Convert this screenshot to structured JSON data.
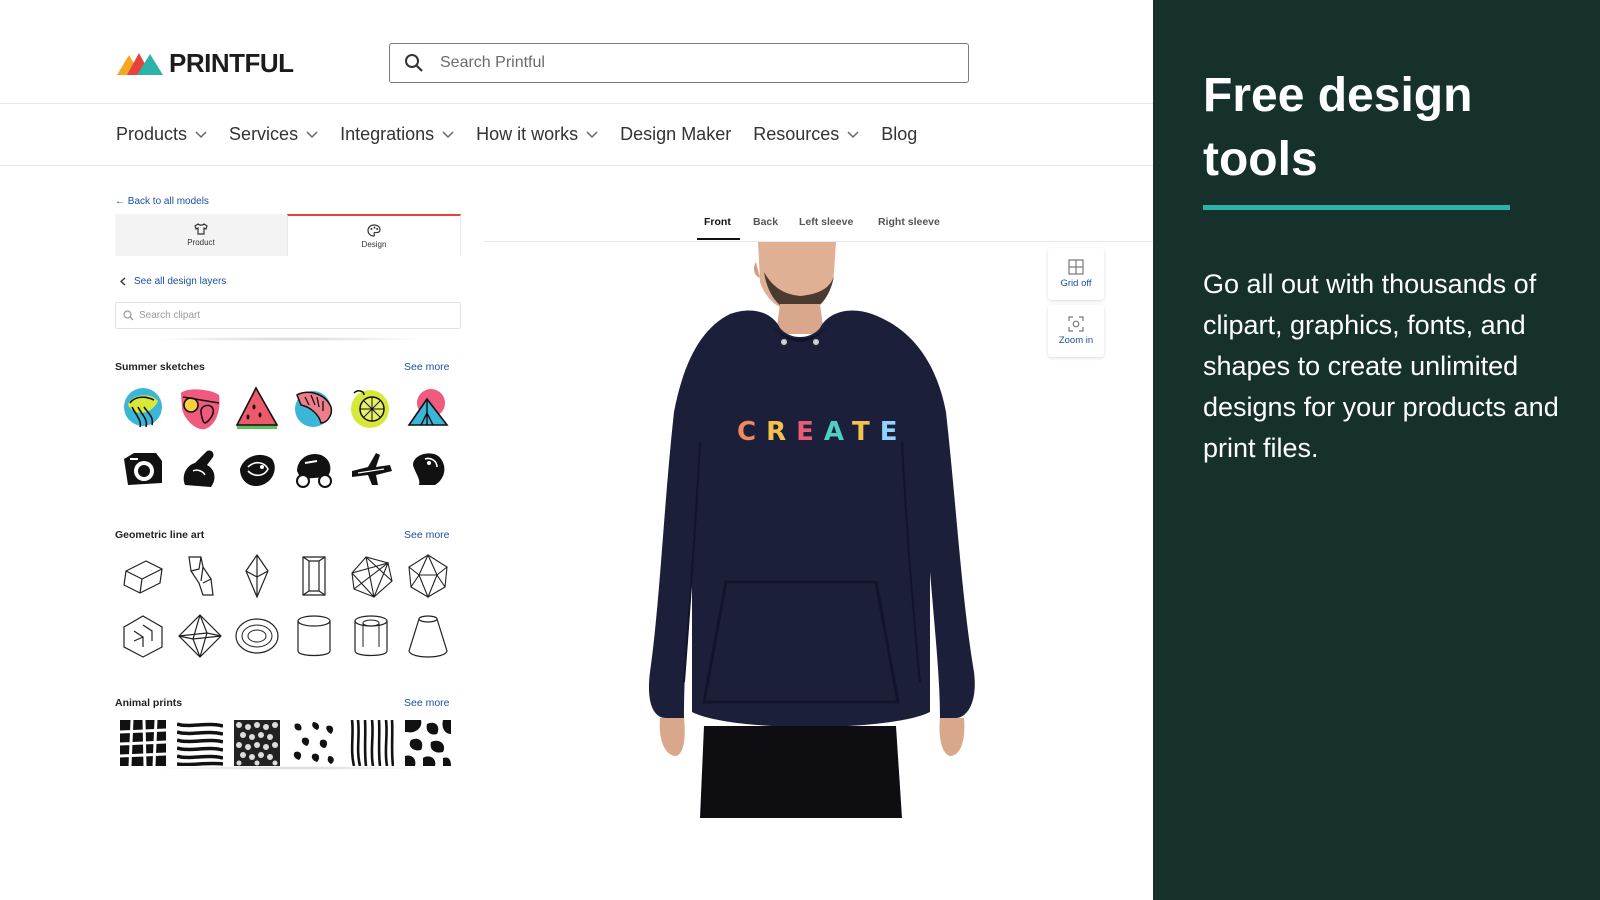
{
  "header": {
    "logo_text": "PRINTFUL",
    "search_placeholder": "Search Printful"
  },
  "nav": {
    "items": [
      {
        "label": "Products",
        "has_dropdown": true
      },
      {
        "label": "Services",
        "has_dropdown": true
      },
      {
        "label": "Integrations",
        "has_dropdown": true
      },
      {
        "label": "How it works",
        "has_dropdown": true
      },
      {
        "label": "Design Maker",
        "has_dropdown": false
      },
      {
        "label": "Resources",
        "has_dropdown": true
      },
      {
        "label": "Blog",
        "has_dropdown": false
      }
    ]
  },
  "editor": {
    "back_link": "← Back to all models",
    "mode_tabs": [
      {
        "label": "Product",
        "active": false
      },
      {
        "label": "Design",
        "active": true
      }
    ],
    "layers_link": "See all design layers",
    "clipart_search_placeholder": "Search clipart",
    "sections": [
      {
        "title": "Summer sketches",
        "see_more": "See more"
      },
      {
        "title": "Geometric line art",
        "see_more": "See more"
      },
      {
        "title": "Animal prints",
        "see_more": "See more"
      }
    ]
  },
  "preview": {
    "view_tabs": [
      {
        "label": "Front",
        "active": true
      },
      {
        "label": "Back",
        "active": false
      },
      {
        "label": "Left sleeve",
        "active": false
      },
      {
        "label": "Right sleeve",
        "active": false
      }
    ],
    "tools": [
      {
        "label": "Grid off",
        "icon": "grid-icon"
      },
      {
        "label": "Zoom in",
        "icon": "zoom-in-icon"
      }
    ],
    "shirt_print": "CREATE",
    "print_letter_colors": [
      "#f08a5d",
      "#f2c14e",
      "#e85d75",
      "#4dd0c4",
      "#f2c14e",
      "#8fd3ff"
    ],
    "hoodie_color": "#1c1f3a"
  },
  "promo": {
    "title": "Free design tools",
    "body": "Go all out with thousands of clipart, graphics, fonts, and shapes to create unlimited designs for your products and print files.",
    "background": "#16302b",
    "accent": "#2bb3a8"
  }
}
